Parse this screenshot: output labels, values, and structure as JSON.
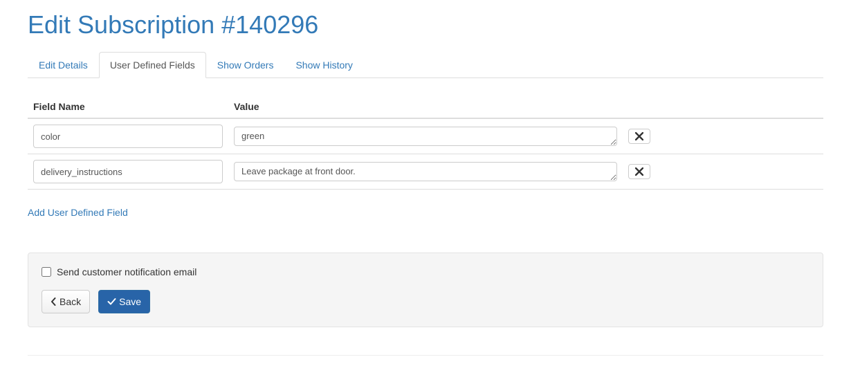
{
  "page": {
    "title": "Edit Subscription #140296"
  },
  "tabs": [
    {
      "label": "Edit Details",
      "active": false
    },
    {
      "label": "User Defined Fields",
      "active": true
    },
    {
      "label": "Show Orders",
      "active": false
    },
    {
      "label": "Show History",
      "active": false
    }
  ],
  "table": {
    "headers": {
      "name": "Field Name",
      "value": "Value"
    },
    "rows": [
      {
        "name": "color",
        "value": "green"
      },
      {
        "name": "delivery_instructions",
        "value": "Leave package at front door."
      }
    ]
  },
  "actions": {
    "add_field": "Add User Defined Field",
    "notify_label": "Send customer notification email",
    "notify_checked": false,
    "back": "Back",
    "save": "Save"
  }
}
